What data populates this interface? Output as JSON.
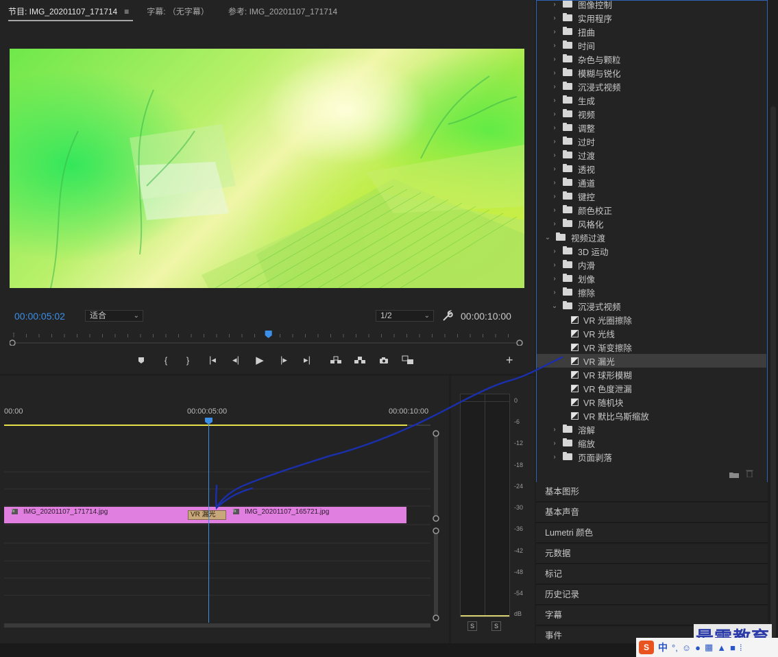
{
  "monitor": {
    "tabs": [
      {
        "label": "节目: IMG_20201107_171714",
        "menu": "≡"
      },
      {
        "label": "字幕: （无字幕）"
      },
      {
        "label": "参考: IMG_20201107_171714"
      }
    ],
    "current_time": "00:00:05:02",
    "duration": "00:00:10:00",
    "zoom": "适合",
    "resolution": "1/2",
    "playhead_fraction": 0.505
  },
  "timeline": {
    "ruler": [
      "00:00",
      "00:00:05:00",
      "00:00:10:00"
    ],
    "clips": [
      {
        "name": "IMG_20201107_171714.jpg",
        "fx": "fx"
      },
      {
        "name": "IMG_20201107_165721.jpg",
        "fx": "fx"
      }
    ],
    "transition": "VR 漏光"
  },
  "audio_meter": {
    "scale": [
      "0",
      "-6",
      "-12",
      "-18",
      "-24",
      "-30",
      "-36",
      "-42",
      "-48",
      "-54",
      "dB"
    ],
    "solo_left": "S",
    "solo_right": "S"
  },
  "effects": {
    "items": [
      {
        "type": "folder",
        "label": "图像控制",
        "expanded": false,
        "depth": 1
      },
      {
        "type": "folder",
        "label": "实用程序",
        "expanded": false,
        "depth": 1
      },
      {
        "type": "folder",
        "label": "扭曲",
        "expanded": false,
        "depth": 1
      },
      {
        "type": "folder",
        "label": "时间",
        "expanded": false,
        "depth": 1
      },
      {
        "type": "folder",
        "label": "杂色与颗粒",
        "expanded": false,
        "depth": 1
      },
      {
        "type": "folder",
        "label": "模糊与锐化",
        "expanded": false,
        "depth": 1
      },
      {
        "type": "folder",
        "label": "沉浸式视频",
        "expanded": false,
        "depth": 1
      },
      {
        "type": "folder",
        "label": "生成",
        "expanded": false,
        "depth": 1
      },
      {
        "type": "folder",
        "label": "视频",
        "expanded": false,
        "depth": 1
      },
      {
        "type": "folder",
        "label": "调整",
        "expanded": false,
        "depth": 1
      },
      {
        "type": "folder",
        "label": "过时",
        "expanded": false,
        "depth": 1
      },
      {
        "type": "folder",
        "label": "过渡",
        "expanded": false,
        "depth": 1
      },
      {
        "type": "folder",
        "label": "透视",
        "expanded": false,
        "depth": 1
      },
      {
        "type": "folder",
        "label": "通道",
        "expanded": false,
        "depth": 1
      },
      {
        "type": "folder",
        "label": "键控",
        "expanded": false,
        "depth": 1
      },
      {
        "type": "folder",
        "label": "颜色校正",
        "expanded": false,
        "depth": 1
      },
      {
        "type": "folder",
        "label": "风格化",
        "expanded": false,
        "depth": 1
      },
      {
        "type": "folder",
        "label": "视频过渡",
        "expanded": true,
        "depth": 0
      },
      {
        "type": "folder",
        "label": "3D 运动",
        "expanded": false,
        "depth": 1
      },
      {
        "type": "folder",
        "label": "内滑",
        "expanded": false,
        "depth": 1
      },
      {
        "type": "folder",
        "label": "划像",
        "expanded": false,
        "depth": 1
      },
      {
        "type": "folder",
        "label": "擦除",
        "expanded": false,
        "depth": 1
      },
      {
        "type": "folder",
        "label": "沉浸式视频",
        "expanded": true,
        "depth": 1
      },
      {
        "type": "effect",
        "label": "VR 光圈擦除",
        "depth": 2
      },
      {
        "type": "effect",
        "label": "VR 光线",
        "depth": 2
      },
      {
        "type": "effect",
        "label": "VR 渐变擦除",
        "depth": 2
      },
      {
        "type": "effect",
        "label": "VR 漏光",
        "depth": 2,
        "selected": true
      },
      {
        "type": "effect",
        "label": "VR 球形模糊",
        "depth": 2
      },
      {
        "type": "effect",
        "label": "VR 色度泄漏",
        "depth": 2
      },
      {
        "type": "effect",
        "label": "VR 随机块",
        "depth": 2
      },
      {
        "type": "effect",
        "label": "VR 默比乌斯缩放",
        "depth": 2
      },
      {
        "type": "folder",
        "label": "溶解",
        "expanded": false,
        "depth": 1
      },
      {
        "type": "folder",
        "label": "缩放",
        "expanded": false,
        "depth": 1
      },
      {
        "type": "folder",
        "label": "页面剥落",
        "expanded": false,
        "depth": 1
      }
    ]
  },
  "panels": [
    "基本图形",
    "基本声音",
    "Lumetri 颜色",
    "元数据",
    "标记",
    "历史记录",
    "字幕",
    "事件"
  ],
  "watermark": "最需教育",
  "ime": {
    "logo": "S",
    "lang": "中",
    "punct": "°,"
  },
  "colors": {
    "accent": "#3b8fe8",
    "clip": "#e07fe0",
    "transition": "#c8a87a",
    "work_area": "#e8e04a",
    "annotation": "#1a2fa8"
  }
}
